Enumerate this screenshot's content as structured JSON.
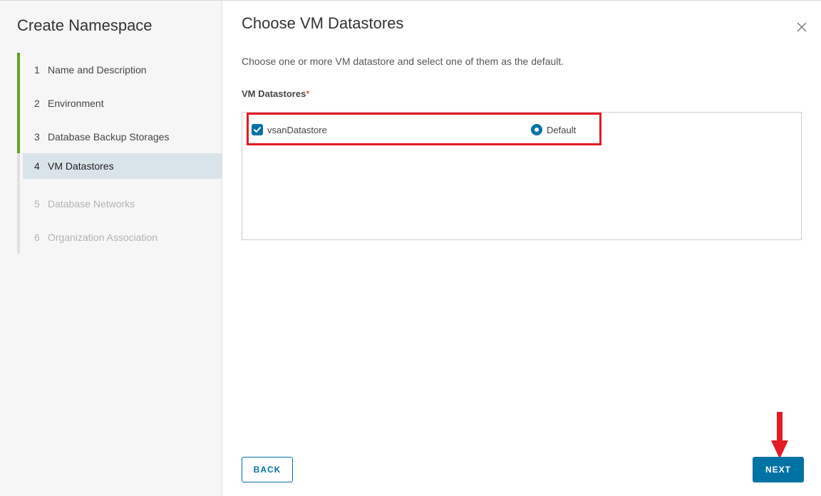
{
  "sidebar": {
    "title": "Create Namespace",
    "steps": [
      {
        "num": "1",
        "label": "Name and Description",
        "state": "done"
      },
      {
        "num": "2",
        "label": "Environment",
        "state": "done"
      },
      {
        "num": "3",
        "label": "Database Backup Storages",
        "state": "done"
      },
      {
        "num": "4",
        "label": "VM Datastores",
        "state": "active"
      },
      {
        "num": "5",
        "label": "Database Networks",
        "state": "disabled"
      },
      {
        "num": "6",
        "label": "Organization Association",
        "state": "disabled"
      }
    ]
  },
  "main": {
    "title": "Choose VM Datastores",
    "description": "Choose one or more VM datastore and select one of them as the default.",
    "field_label": "VM Datastores",
    "required_mark": "*",
    "datastores": [
      {
        "name": "vsanDatastore",
        "checked": true,
        "default_label": "Default",
        "is_default": true
      }
    ]
  },
  "footer": {
    "back_label": "BACK",
    "next_label": "NEXT"
  },
  "colors": {
    "accent": "#0072a3",
    "done_step": "#62a420",
    "active_step_bg": "#d9e4ea",
    "highlight_annotation": "#e31b23"
  },
  "icons": {
    "close": "close-icon",
    "checkbox": "checkmark-icon",
    "annotation": "arrow-down-icon"
  }
}
